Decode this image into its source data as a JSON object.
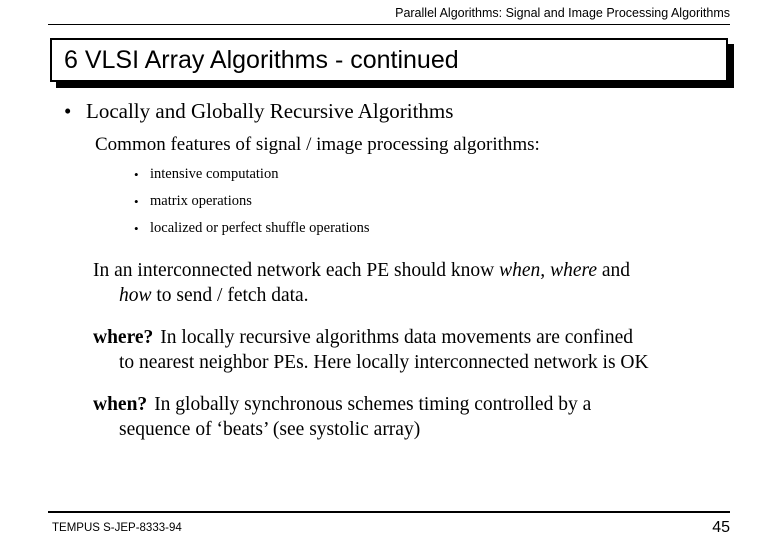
{
  "header": {
    "running_title": "Parallel Algorithms:  Signal and Image Processing Algorithms"
  },
  "title": {
    "text": "6 VLSI  Array  Algorithms - continued"
  },
  "body": {
    "bullet_glyph": "•",
    "sub_bullet_glyph": "•",
    "level1": [
      {
        "label": "Locally and Globally Recursive Algorithms"
      }
    ],
    "level2": [
      {
        "label": "Common features of signal / image processing algorithms:"
      }
    ],
    "level3": [
      {
        "label": "intensive computation"
      },
      {
        "label": "matrix operations"
      },
      {
        "label": "localized or perfect shuffle operations"
      }
    ],
    "paragraphs": [
      {
        "id": "interconnected-network",
        "line1_a": "In an interconnected network each PE should know ",
        "line1_italic1": "when, ",
        "line1_italic2": "where",
        "line1_b": " and",
        "line2_italic": "how",
        "line2_b": " to send / fetch data."
      },
      {
        "id": "where-question",
        "lead": "where?",
        "line1": "In locally recursive algorithms data movements are confined",
        "line2": "to nearest neighbor PEs. Here locally interconnected network is OK"
      },
      {
        "id": "when-question",
        "lead": "when?",
        "line1": "In globally synchronous schemes timing controlled by a",
        "line2": "sequence of ‘beats’ (see systolic array)"
      }
    ]
  },
  "footer": {
    "project_code": "TEMPUS S-JEP-8333-94",
    "page_number": "45"
  },
  "colors": {
    "text": "#000000",
    "background": "#ffffff",
    "rule": "#000000"
  }
}
